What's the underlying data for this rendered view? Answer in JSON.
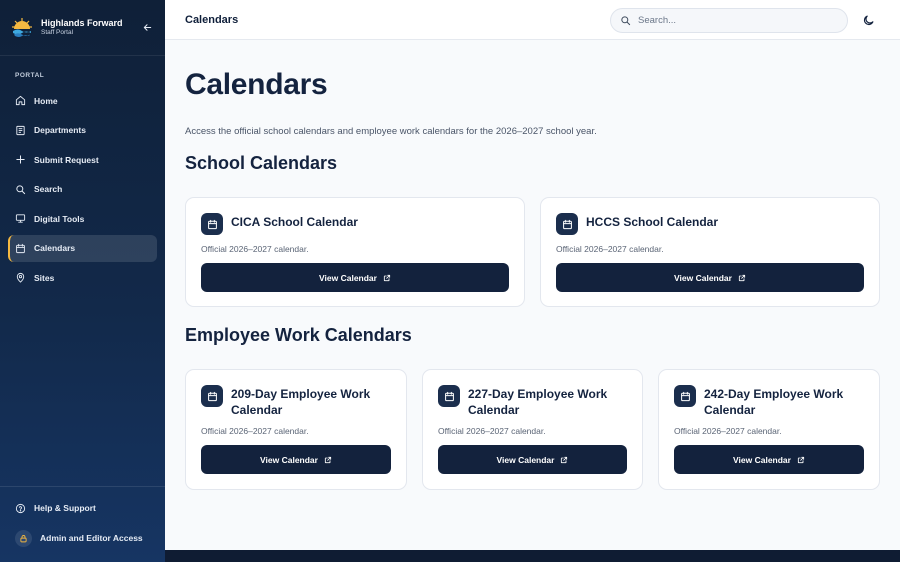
{
  "brand": {
    "title": "Highlands Forward",
    "subtitle": "Staff Portal"
  },
  "sidebar": {
    "section_label": "PORTAL",
    "items": [
      {
        "label": "Home",
        "icon": "home-icon"
      },
      {
        "label": "Departments",
        "icon": "building-icon"
      },
      {
        "label": "Submit Request",
        "icon": "plus-icon"
      },
      {
        "label": "Search",
        "icon": "search-icon"
      },
      {
        "label": "Digital Tools",
        "icon": "monitor-icon"
      },
      {
        "label": "Calendars",
        "icon": "calendar-icon",
        "active": true
      },
      {
        "label": "Sites",
        "icon": "map-pin-icon"
      }
    ],
    "bottom": {
      "help_label": "Help & Support",
      "admin_label": "Admin and Editor Access"
    }
  },
  "topbar": {
    "title": "Calendars",
    "search_placeholder": "Search..."
  },
  "main": {
    "title": "Calendars",
    "description": "Access the official school calendars and employee work calendars for the 2026–2027 school year.",
    "school_section_title": "School Calendars",
    "employee_section_title": "Employee Work Calendars",
    "school_cards": [
      {
        "title": "CICA School Calendar",
        "subtitle": "Official 2026–2027 calendar.",
        "button": "View Calendar"
      },
      {
        "title": "HCCS School Calendar",
        "subtitle": "Official 2026–2027 calendar.",
        "button": "View Calendar"
      }
    ],
    "employee_cards": [
      {
        "title": "209-Day Employee Work Calendar",
        "subtitle": "Official 2026–2027 calendar.",
        "button": "View Calendar"
      },
      {
        "title": "227-Day Employee Work Calendar",
        "subtitle": "Official 2026–2027 calendar.",
        "button": "View Calendar"
      },
      {
        "title": "242-Day Employee Work Calendar",
        "subtitle": "Official 2026–2027 calendar.",
        "button": "View Calendar"
      }
    ]
  },
  "colors": {
    "sidebar_bg": "#0f2038",
    "accent": "#f5b941",
    "button_bg": "#13223d",
    "page_bg": "#f8fafc"
  }
}
